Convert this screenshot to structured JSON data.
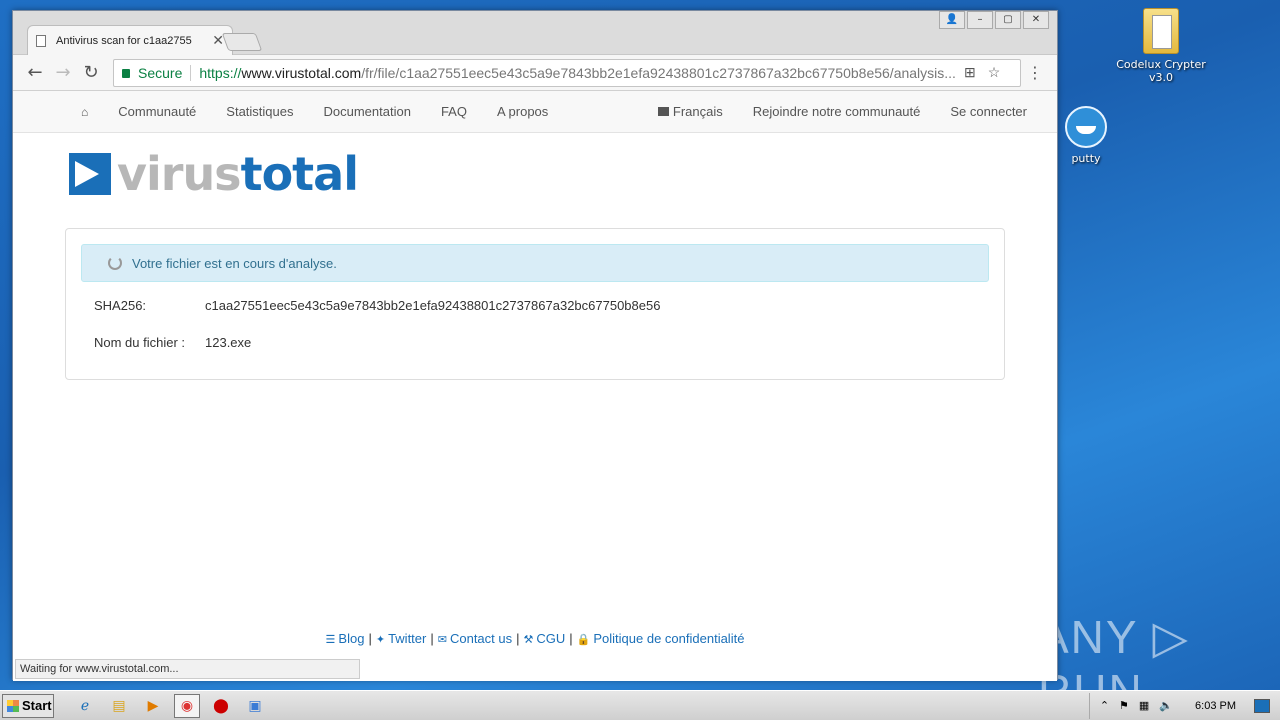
{
  "desktop": {
    "icons": [
      {
        "label": "Codelux Crypter v3.0",
        "icon": "folder-icon"
      },
      {
        "label": "putty",
        "icon": "putty-icon"
      }
    ],
    "watermark": "ANY ▷ RUN"
  },
  "browser": {
    "tab_title": "Antivirus scan for c1aa2755",
    "omnibox": {
      "secure_label": "Secure",
      "url_scheme": "https://",
      "url_host": "www.virustotal.com",
      "url_rest": "/fr/file/c1aa27551eec5e43c5a9e7843bb2e1efa92438801c2737867a32bc67750b8e56/analysis..."
    },
    "status_text": "Waiting for www.virustotal.com..."
  },
  "site": {
    "nav": {
      "items": [
        "Communauté",
        "Statistiques",
        "Documentation",
        "FAQ",
        "A propos"
      ],
      "language": "Français",
      "join": "Rejoindre notre communauté",
      "login": "Se connecter"
    },
    "logo": {
      "part1": "virus",
      "part2": "total"
    },
    "alert": "Votre fichier est en cours d'analyse.",
    "sha_label": "SHA256:",
    "sha_value": "c1aa27551eec5e43c5a9e7843bb2e1efa92438801c2737867a32bc67750b8e56",
    "filename_label": "Nom du fichier :",
    "filename_value": "123.exe",
    "footer": {
      "blog": "Blog",
      "twitter": "Twitter",
      "contact": "Contact us",
      "cgu": "CGU",
      "privacy": "Politique de confidentialité"
    }
  },
  "taskbar": {
    "start_label": "Start",
    "clock": "6:03 PM"
  },
  "colors": {
    "brand": "#1a6fb8",
    "secure": "#0b8043",
    "alert_bg": "#d9edf7"
  }
}
